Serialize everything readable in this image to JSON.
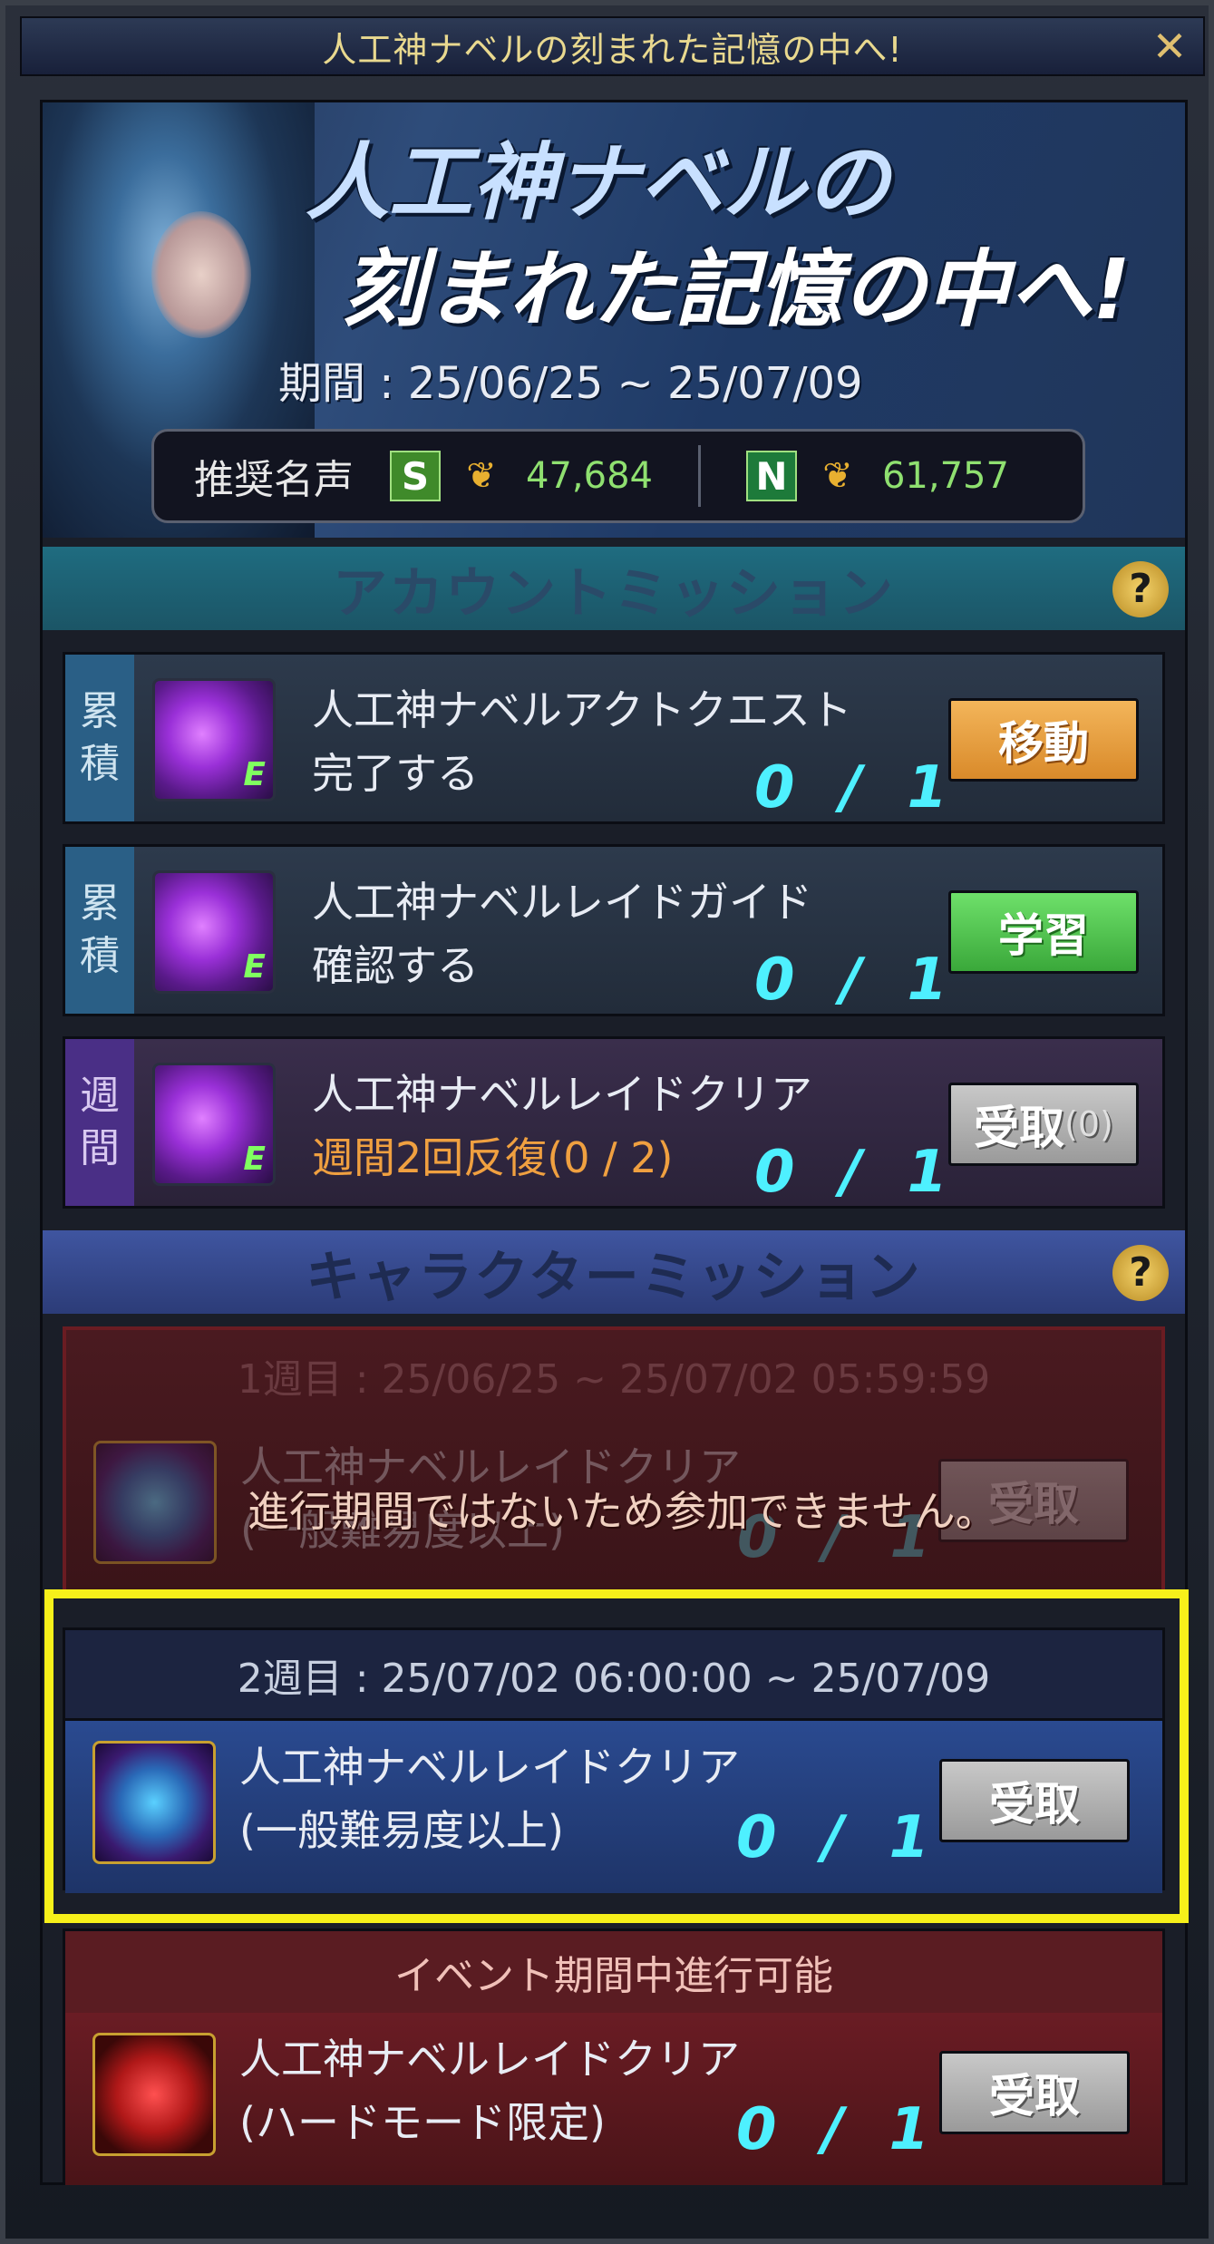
{
  "window": {
    "title": "人工神ナベルの刻まれた記憶の中へ!",
    "close_label": "✕"
  },
  "banner": {
    "title_line1": "人工神ナベルの",
    "title_line2": "刻まれた記憶の中へ!",
    "period": "期間 : 25/06/25 ~ 25/07/09",
    "fame_label": "推奨名声",
    "fame_s_badge": "S",
    "fame_s_value": "47,684",
    "fame_n_badge": "N",
    "fame_n_value": "61,757"
  },
  "account_section": {
    "title": "アカウントミッション",
    "help": "?",
    "missions": [
      {
        "tag1": "累",
        "tag2": "積",
        "name": "人工神ナベルアクトクエスト",
        "sub": "完了する",
        "progress": "0 / 1",
        "button": "移動"
      },
      {
        "tag1": "累",
        "tag2": "積",
        "name": "人工神ナベルレイドガイド",
        "sub": "確認する",
        "progress": "0 / 1",
        "button": "学習"
      },
      {
        "tag1": "週",
        "tag2": "間",
        "name": "人工神ナベルレイドクリア",
        "sub": "週間2回反復(0 / 2)",
        "progress": "0 / 1",
        "button": "受取",
        "button_count": "(0)"
      }
    ]
  },
  "character_section": {
    "title": "キャラクターミッション",
    "help": "?",
    "week1": {
      "header": "1週目 : 25/06/25 ~ 25/07/02 05:59:59",
      "name": "人工神ナベルレイドクリア",
      "sub": "(一般難易度以上)",
      "progress": "0 / 1",
      "button": "受取",
      "notice": "進行期間ではないため参加できません。"
    },
    "week2": {
      "header": "2週目 : 25/07/02 06:00:00 ~ 25/07/09",
      "name": "人工神ナベルレイドクリア",
      "sub": "(一般難易度以上)",
      "progress": "0 / 1",
      "button": "受取"
    },
    "event": {
      "header": "イベント期間中進行可能",
      "name": "人工神ナベルレイドクリア",
      "sub": "(ハードモード限定)",
      "progress": "0 / 1",
      "button": "受取"
    }
  }
}
